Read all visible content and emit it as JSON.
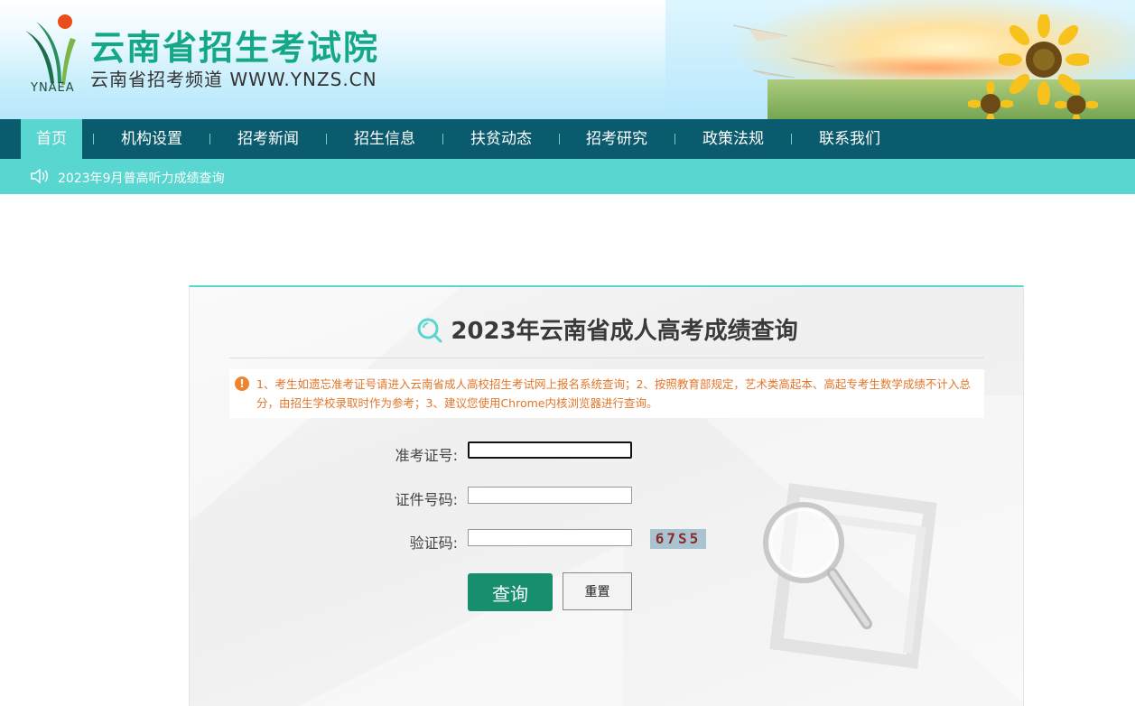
{
  "header": {
    "logo_text": "YNAEA",
    "site_title": "云南省招生考试院",
    "site_subtitle": "云南省招考频道  WWW.YNZS.CN"
  },
  "nav": {
    "items": [
      {
        "label": "首页",
        "active": true
      },
      {
        "label": "机构设置"
      },
      {
        "label": "招考新闻"
      },
      {
        "label": "招生信息"
      },
      {
        "label": "扶贫动态"
      },
      {
        "label": "招考研究"
      },
      {
        "label": "政策法规"
      },
      {
        "label": "联系我们"
      }
    ]
  },
  "notice": {
    "icon": "speaker-icon",
    "text": "2023年9月普高听力成绩查询"
  },
  "panel": {
    "title": "2023年云南省成人高考成绩查询",
    "tip_icon": "!",
    "tip": "1、考生如遗忘准考证号请进入云南省成人高校招生考试网上报名系统查询；2、按照教育部规定，艺术类高起本、高起专考生数学成绩不计入总分，由招生学校录取时作为参考；3、建议您使用Chrome内核浏览器进行查询。",
    "form": {
      "exam_id_label": "准考证号:",
      "exam_id_value": "",
      "id_number_label": "证件号码:",
      "id_number_value": "",
      "captcha_label": "验证码:",
      "captcha_value": "",
      "captcha_image_text": "67S5"
    },
    "buttons": {
      "query": "查询",
      "reset": "重置"
    }
  },
  "colors": {
    "nav_bg": "#0a5b6e",
    "accent": "#58d6cf",
    "brand_green": "#14a889",
    "button_green": "#178f6f",
    "tip_orange": "#e2762a"
  }
}
